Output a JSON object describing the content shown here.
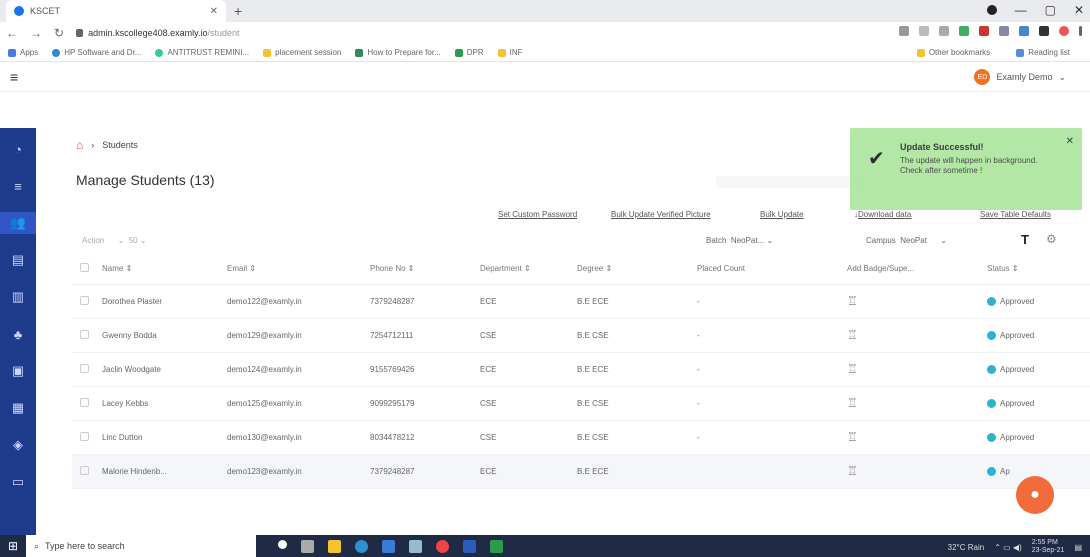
{
  "browser": {
    "tab_title": "KSCET",
    "url_host": "admin.kscollege408.examly.io",
    "url_path": "/student",
    "bookmarks": [
      "Apps",
      "HP Software and Dr...",
      "ANTITRUST REMINI...",
      "placement session",
      "How to Prepare for...",
      "DPR",
      "INF"
    ],
    "other_bookmarks": "Other bookmarks",
    "reading_list": "Reading list"
  },
  "app": {
    "user_initials": "ED",
    "user_name": "Examly Demo"
  },
  "breadcrumb": {
    "current": "Students"
  },
  "page_title": "Manage Students (13)",
  "actions": {
    "set_password": "Set Custom Password",
    "bulk_verified_picture": "Bulk Update Verified Picture",
    "bulk_update": "Bulk Update",
    "download_data": "Download data",
    "save_defaults": "Save Table Defaults"
  },
  "filters": {
    "action": "Action",
    "page_size": "50",
    "batch_label": "Batch",
    "batch_value": "NeoPat...",
    "campus_label": "Campus",
    "campus_value": "NeoPat"
  },
  "table": {
    "headers": [
      "Name ⇕",
      "Email ⇕",
      "Phone No ⇕",
      "Department ⇕",
      "Degree ⇕",
      "Placed Count",
      "Add Badge/Supe...",
      "Status ⇕"
    ],
    "rows": [
      {
        "name": "Dorothea Plaster",
        "email": "demo122@examly.in",
        "phone": "7379248287",
        "dept": "ECE",
        "degree": "B.E ECE",
        "placed": "-",
        "status": "Approved"
      },
      {
        "name": "Gwenny Bodda",
        "email": "demo129@examly.in",
        "phone": "7254712111",
        "dept": "CSE",
        "degree": "B.E CSE",
        "placed": "-",
        "status": "Approved"
      },
      {
        "name": "Jaclin Woodgate",
        "email": "demo124@examly.in",
        "phone": "9155769426",
        "dept": "ECE",
        "degree": "B.E ECE",
        "placed": "-",
        "status": "Approved"
      },
      {
        "name": "Lacey Kebbs",
        "email": "demo125@examly.in",
        "phone": "9099295179",
        "dept": "CSE",
        "degree": "B.E CSE",
        "placed": "-",
        "status": "Approved"
      },
      {
        "name": "Linc Dutton",
        "email": "demo130@examly.in",
        "phone": "8034478212",
        "dept": "CSE",
        "degree": "B.E CSE",
        "placed": "-",
        "status": "Approved"
      },
      {
        "name": "Malorie Hindenb...",
        "email": "demo123@examly.in",
        "phone": "7379248287",
        "dept": "ECE",
        "degree": "B.E ECE",
        "placed": "",
        "status": "Ap"
      }
    ]
  },
  "toast": {
    "title": "Update Successful!",
    "message": "The update will happen in background. Check after sometime !"
  },
  "taskbar": {
    "search_placeholder": "Type here to search",
    "weather": "32°C Rain",
    "time": "2:55 PM",
    "date": "23-Sep-21"
  }
}
